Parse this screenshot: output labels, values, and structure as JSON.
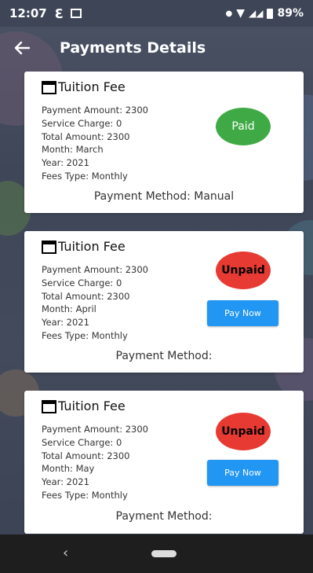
{
  "status_bar": {
    "time": "12:07",
    "battery": "89%"
  },
  "app_bar": {
    "title": "Payments Details"
  },
  "payments": [
    {
      "title": "Tuition Fee",
      "payment_amount": "Payment Amount: 2300",
      "service_charge": "Service Charge: 0",
      "total_amount": "Total Amount: 2300",
      "month": "Month:  March",
      "year": "Year:  2021",
      "fees_type": "Fees Type: Monthly",
      "status": "Paid",
      "method": "Payment Method: Manual"
    },
    {
      "title": "Tuition Fee",
      "payment_amount": "Payment Amount: 2300",
      "service_charge": "Service Charge: 0",
      "total_amount": "Total Amount: 2300",
      "month": "Month:  April",
      "year": "Year:  2021",
      "fees_type": "Fees Type: Monthly",
      "status": "Unpaid",
      "pay_button": "Pay Now",
      "method": "Payment Method:"
    },
    {
      "title": "Tuition Fee",
      "payment_amount": "Payment Amount: 2300",
      "service_charge": "Service Charge: 0",
      "total_amount": "Total Amount: 2300",
      "month": "Month:  May",
      "year": "Year:  2021",
      "fees_type": "Fees Type: Monthly",
      "status": "Unpaid",
      "pay_button": "Pay Now",
      "method": "Payment Method:"
    }
  ],
  "icons": {
    "back": "arrow-back-icon",
    "calendar": "calendar-icon",
    "nav_back": "chevron-left-icon",
    "nav_home": "home-pill-icon"
  },
  "colors": {
    "paid": "#3faa45",
    "unpaid": "#e73a32",
    "pay_button": "#2196f3"
  }
}
